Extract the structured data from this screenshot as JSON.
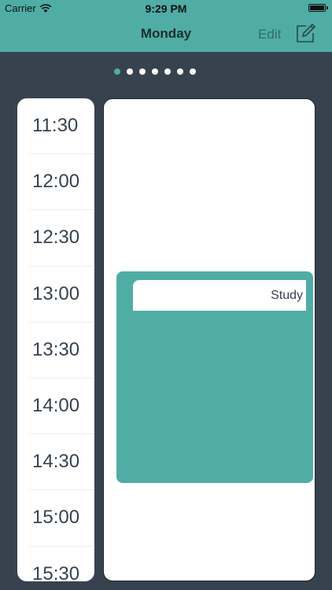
{
  "status_bar": {
    "carrier": "Carrier",
    "time": "9:29 PM"
  },
  "nav": {
    "title": "Monday",
    "edit_label": "Edit"
  },
  "pager": {
    "total_pages": 7,
    "current_page": 1
  },
  "timeline": {
    "slots": [
      "11:30",
      "12:00",
      "12:30",
      "13:00",
      "13:30",
      "14:00",
      "14:30",
      "15:00",
      "15:30"
    ]
  },
  "events": [
    {
      "title": "Study"
    }
  ],
  "colors": {
    "accent": "#4fada5",
    "background": "#37424f",
    "panel": "#ffffff"
  },
  "icons": {
    "wifi": "wifi-icon",
    "battery": "battery-icon",
    "compose": "compose-icon"
  }
}
